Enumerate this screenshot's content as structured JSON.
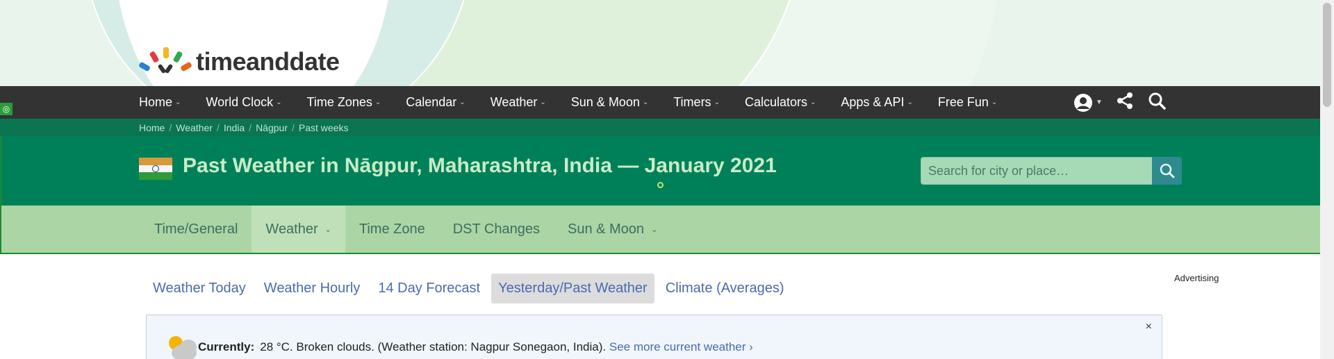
{
  "brand": {
    "logo_text": "timeanddate"
  },
  "topnav": {
    "items": [
      {
        "label": "Home"
      },
      {
        "label": "World Clock"
      },
      {
        "label": "Time Zones"
      },
      {
        "label": "Calendar"
      },
      {
        "label": "Weather"
      },
      {
        "label": "Sun & Moon"
      },
      {
        "label": "Timers"
      },
      {
        "label": "Calculators"
      },
      {
        "label": "Apps & API"
      },
      {
        "label": "Free Fun"
      }
    ],
    "icons": [
      "user-account-icon",
      "share-icon",
      "search-icon"
    ]
  },
  "breadcrumb": [
    "Home",
    "Weather",
    "India",
    "Nāgpur",
    "Past weeks"
  ],
  "header": {
    "title": "Past Weather in Nāgpur, Maharashtra, India — January 2021",
    "search_placeholder": "Search for city or place…"
  },
  "subnav": {
    "tabs": [
      {
        "label": "Time/General",
        "active": false,
        "dropdown": false
      },
      {
        "label": "Weather",
        "active": true,
        "dropdown": true
      },
      {
        "label": "Time Zone",
        "active": false,
        "dropdown": false
      },
      {
        "label": "DST Changes",
        "active": false,
        "dropdown": false
      },
      {
        "label": "Sun & Moon",
        "active": false,
        "dropdown": true
      }
    ]
  },
  "weather_tabs": [
    {
      "label": "Weather Today",
      "active": false
    },
    {
      "label": "Weather Hourly",
      "active": false
    },
    {
      "label": "14 Day Forecast",
      "active": false
    },
    {
      "label": "Yesterday/Past Weather",
      "active": true
    },
    {
      "label": "Climate (Averages)",
      "active": false
    }
  ],
  "advertising_label": "Advertising",
  "current": {
    "label": "Currently:",
    "text": "28 °C. Broken clouds. (Weather station: Nagpur Sonegaon, India).",
    "link": "See more current weather",
    "close": "×"
  },
  "colors": {
    "nav_bg": "#333333",
    "green_band": "#008059",
    "subnav_bg": "#acd5a5",
    "link": "#4a6ab0"
  }
}
